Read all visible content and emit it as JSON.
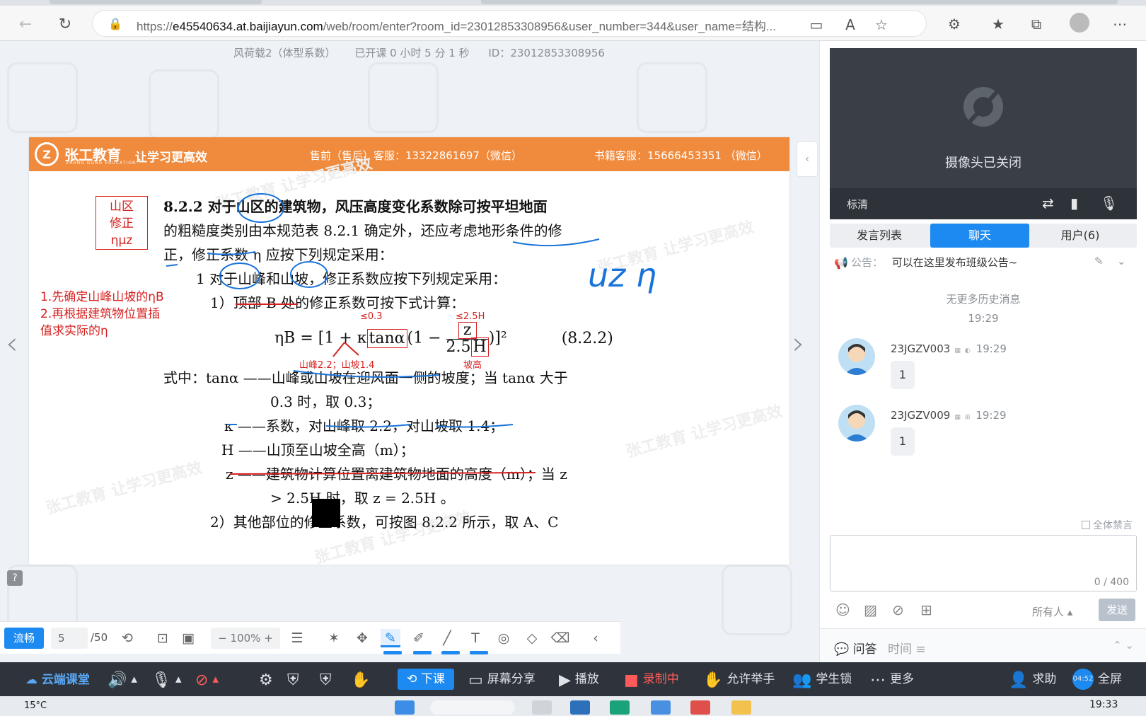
{
  "browser": {
    "url_prefix": "https://",
    "url_host": "e45540634.at.baijiayun.com",
    "url_path": "/web/room/enter?room_id=23012853308956&user_number=344&user_name=结构..."
  },
  "course": {
    "title": "风荷载2（体型系数）",
    "elapsed": "已开课 0 小时 5 分 1 秒",
    "id": "ID：23012853308956"
  },
  "slide": {
    "header": {
      "brand": "张工教育",
      "brand_en": "ZHANG GONG EDUCATION",
      "slogan": "让学习更高效",
      "service1": "售前（售后）客服：13322861697（微信）",
      "service2": "书籍客服：15666453351 （微信）"
    },
    "redbox": [
      "山区",
      "修正",
      "ημz"
    ],
    "steps": [
      "1.先确定山峰山坡的ηB",
      "2.再根据建筑物位置插",
      "值求实际的η"
    ],
    "lines": {
      "l1": "8.2.2   对于山区的建筑物，风压高度变化系数除可按平坦地面",
      "l2": "的粗糙度类别由本规范表 8.2.1 确定外，还应考虑地形条件的修",
      "l3": "正，修正系数 η 应按下列规定采用：",
      "l4": "1   对于山峰和山坡，修正系数应按下列规定采用：",
      "l5": "1）顶部 B 处的修正系数可按下式计算：",
      "formula_lhs": "ηB = [1 + κ",
      "formula_tan": "tanα",
      "formula_mid": "(1 − ",
      "formula_z": "z",
      "formula_den": "2.5",
      "formula_H": "H",
      "formula_end": ")]²",
      "formula_no": "(8.2.2)",
      "l6": "式中：tanα ——山峰或山坡在迎风面一侧的坡度；当 tanα 大于",
      "l7": "0.3 时，取 0.3；",
      "l8": "κ ——系数，对山峰取 2.2，对山坡取 1.4；",
      "l9": "H ——山顶至山坡全高（m）；",
      "l10": "z ——建筑物计算位置离建筑物地面的高度（m）；当 z",
      "l11": "> 2.5H 时，取 z = 2.5H 。",
      "l12": "2）其他部位的修正系数，可按图 8.2.2 所示，取 A、C"
    },
    "annot": {
      "le03": "≤0.3",
      "le25": "≤2.5H",
      "peak": "山峰2.2；山坡1.4",
      "slope_h": "坡高",
      "hand": "uz η"
    },
    "watermark": "张工教育 让学习更高效"
  },
  "slide_toolbar": {
    "fluency": "流畅",
    "page": "5",
    "total": "/50",
    "zoom": "100%"
  },
  "right": {
    "cam_off": "摄像头已关闭",
    "quality": "标清",
    "tabs": [
      "发言列表",
      "聊天",
      "用户(6)"
    ],
    "notice_label": "公告：",
    "notice_text": "可以在这里发布班级公告~",
    "no_history": "无更多历史消息",
    "history_time": "19:29",
    "messages": [
      {
        "name": "23JGZV003",
        "time": "19:29",
        "text": "1"
      },
      {
        "name": "23JGZV009",
        "time": "19:29",
        "text": "1"
      }
    ],
    "mute_all": "全体禁言",
    "counter": "0 / 400",
    "to_all": "所有人",
    "send": "发送",
    "qa": "问答",
    "qa_time": "时间"
  },
  "controlbar": {
    "logo": "云端课堂",
    "end_class": "下课",
    "screen_share": "屏幕分享",
    "play": "播放",
    "recording": "录制中",
    "raise_hand": "允许举手",
    "student_lock": "学生锁",
    "more": "更多",
    "help": "求助",
    "fullscreen": "全屏",
    "timer": "04:52"
  },
  "taskbar": {
    "weather": "15°C",
    "clock": "19:33"
  }
}
